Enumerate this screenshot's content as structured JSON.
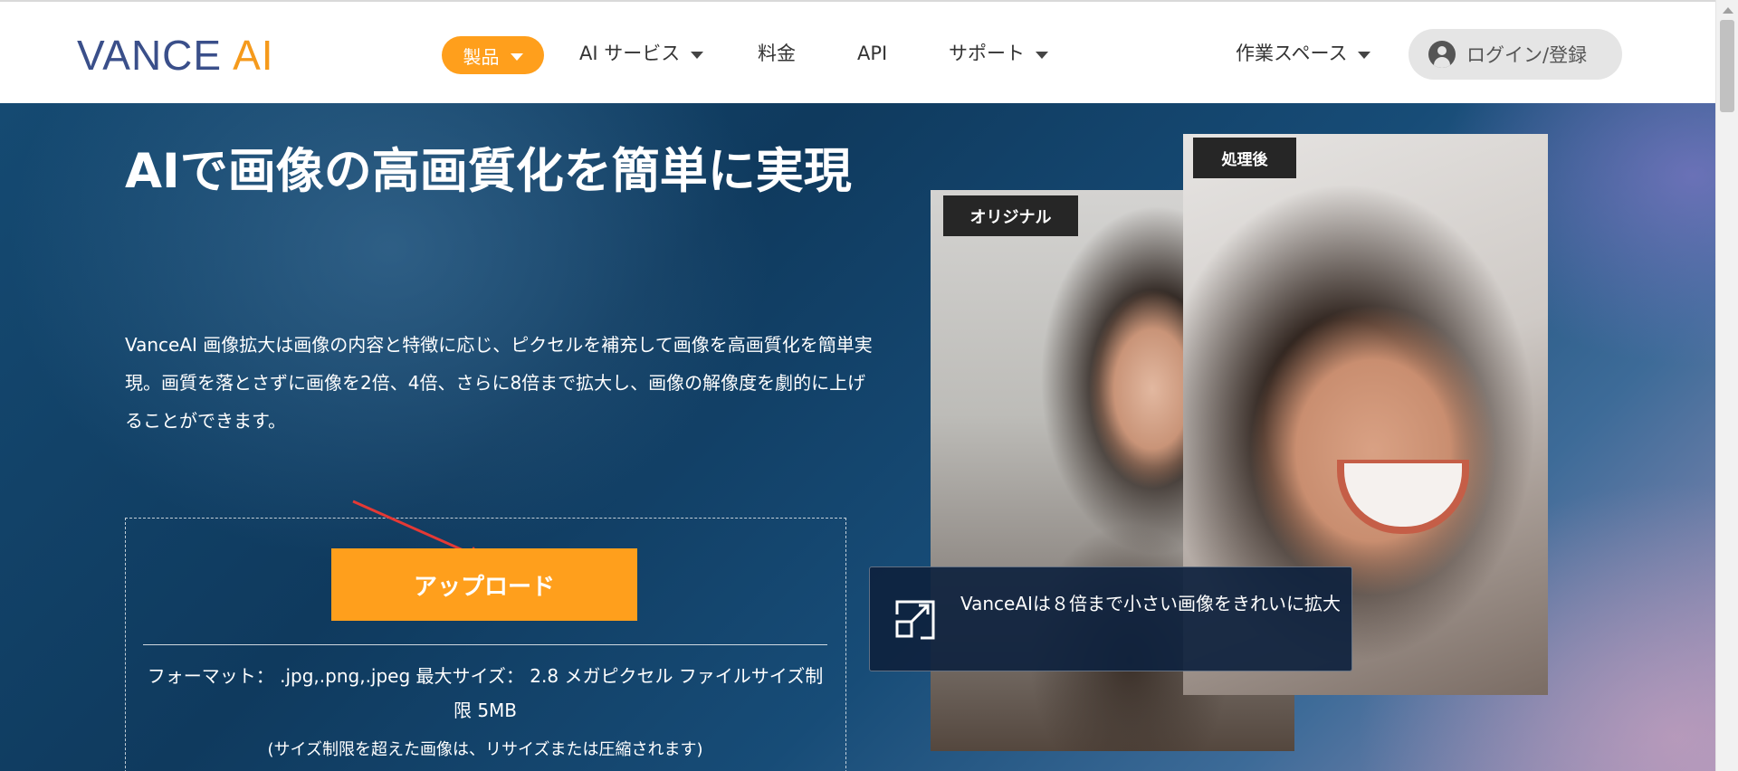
{
  "header": {
    "logo": {
      "vance": "VANCE",
      "ai": "AI"
    },
    "nav": [
      {
        "label": "製品",
        "has_dropdown": true,
        "active": true
      },
      {
        "label": "AI サービス",
        "has_dropdown": true
      },
      {
        "label": "料金",
        "has_dropdown": false
      },
      {
        "label": "API",
        "has_dropdown": false
      },
      {
        "label": "サポート",
        "has_dropdown": true
      }
    ],
    "workspace": {
      "label": "作業スペース",
      "has_dropdown": true
    },
    "login": {
      "label": "ログイン/登録",
      "icon": "user-icon"
    }
  },
  "hero": {
    "title": "AIで画像の高画質化を簡単に実現",
    "description": "VanceAI 画像拡大は画像の内容と特徴に応じ、ピクセルを補充して画像を高画質化を簡単実現。画質を落とさずに画像を2倍、4倍、さらに8倍まで拡大し、画像の解像度を劇的に上げることができます。",
    "upload_button": "アップロード",
    "format_info": "フォーマット： .jpg,.png,.jpeg 最大サイズ： 2.8 メガピクセル ファイルサイズ制限 5MB",
    "limit_note": "(サイズ制限を超えた画像は、リサイズまたは圧縮されます)"
  },
  "comparison": {
    "label_original": "オリジナル",
    "label_after": "処理後",
    "info_icon": "expand-icon",
    "info_text": "VanceAIは８倍まで小さい画像をきれいに拡大"
  },
  "colors": {
    "brand_blue": "#3a4f8a",
    "accent_orange": "#ff9f1c",
    "hero_dark": "#0f3a5e"
  }
}
